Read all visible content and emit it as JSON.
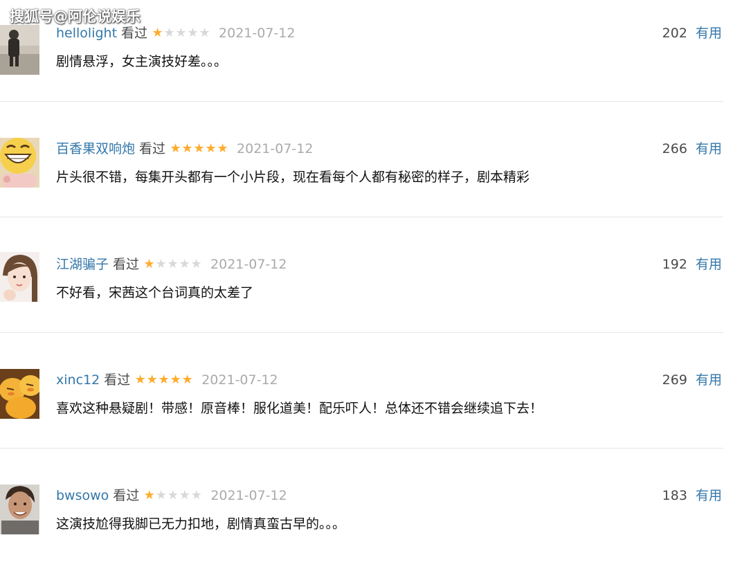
{
  "watermark": "搜狐号@阿伦说娱乐",
  "colors": {
    "link": "#3377aa",
    "star_on": "#ffac2d",
    "star_off": "#d8d8d8",
    "date": "#aaaaaa"
  },
  "reviews": [
    {
      "user": "hellolight",
      "status": "看过",
      "rating": 1,
      "date": "2021-07-12",
      "votes": "202",
      "useful": "有用",
      "content": "剧情悬浮，女主演技好差。。。",
      "avatar": "person-photo"
    },
    {
      "user": "百香果双响炮",
      "status": "看过",
      "rating": 5,
      "date": "2021-07-12",
      "votes": "266",
      "useful": "有用",
      "content": "片头很不错，每集开头都有一个小片段，现在看每个人都有秘密的样子，剧本精彩",
      "avatar": "laughing-face-emoji"
    },
    {
      "user": "江湖骗子",
      "status": "看过",
      "rating": 1,
      "date": "2021-07-12",
      "votes": "192",
      "useful": "有用",
      "content": "不好看，宋茜这个台词真的太差了",
      "avatar": "girl-photo"
    },
    {
      "user": "xinc12",
      "status": "看过",
      "rating": 5,
      "date": "2021-07-12",
      "votes": "269",
      "useful": "有用",
      "content": "喜欢这种悬疑剧！带感！原音棒！服化道美！配乐吓人！总体还不错会继续追下去！",
      "avatar": "yellow-chicks"
    },
    {
      "user": "bwsowo",
      "status": "看过",
      "rating": 1,
      "date": "2021-07-12",
      "votes": "183",
      "useful": "有用",
      "content": "这演技尬得我脚已无力扣地，剧情真蛮古早的。。。",
      "avatar": "man-photo"
    }
  ]
}
